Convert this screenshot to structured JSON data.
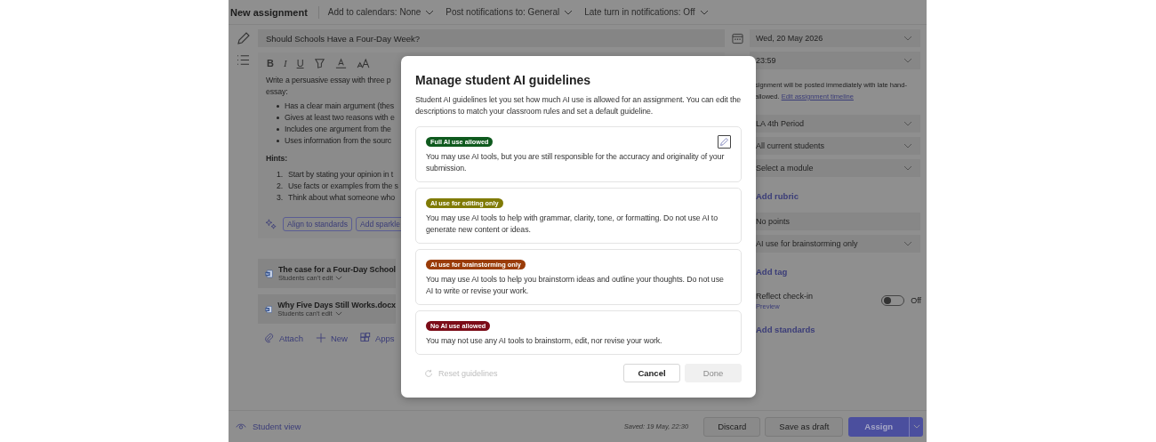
{
  "top_bar": {
    "title": "New assignment",
    "menus": [
      {
        "label": "Add to calendars: None"
      },
      {
        "label": "Post notifications to: General"
      },
      {
        "label": "Late turn in notifications: Off"
      }
    ]
  },
  "title_field": {
    "value": "Should Schools Have a Four-Day Week?"
  },
  "editor": {
    "format_buttons": [
      {
        "kind": "bold",
        "label": "B"
      },
      {
        "kind": "italic",
        "label": "I"
      },
      {
        "kind": "underline",
        "label": "U"
      }
    ],
    "intro": [
      "Write a persuasive essay with three p",
      "essay:"
    ],
    "bullets": [
      "Has a clear main argument (thes",
      "Gives at least two reasons with e",
      "Includes one argument from the",
      "Uses information from the sourc"
    ],
    "hints_heading": "Hints:",
    "steps": [
      {
        "number": "1.",
        "text": "Start by stating your opinion in t"
      },
      {
        "number": "2.",
        "text": "Use facts or examples from the s"
      },
      {
        "number": "3.",
        "text": "Think about what someone who"
      }
    ],
    "ai_buttons": [
      "Align to standards",
      "Add sparkle"
    ]
  },
  "attachments": [
    {
      "name": "The case for a Four-Day School",
      "permission": "Students can't edit"
    },
    {
      "name": "Why Five Days Still Works.docx",
      "permission": "Students can't edit"
    }
  ],
  "attach_actions": [
    {
      "kind": "attach",
      "label": "Attach"
    },
    {
      "kind": "new",
      "label": "New"
    },
    {
      "kind": "apps",
      "label": "Apps"
    }
  ],
  "details": [
    {
      "kind": "dropdown",
      "value": "Wed, 20 May 2026"
    },
    {
      "kind": "dropdown",
      "value": "23:59"
    },
    {
      "kind": "note",
      "lines": [
        "signment will be posted immediately with late hand-",
        "allowed."
      ],
      "link": "Edit assignment timeline"
    },
    {
      "kind": "dropdown",
      "value": "LA 4th Period"
    },
    {
      "kind": "dropdown",
      "value": "All current students"
    },
    {
      "kind": "dropdown",
      "value": "Select a module"
    },
    {
      "kind": "link",
      "label": "Add rubric"
    },
    {
      "kind": "field",
      "value": "No points"
    },
    {
      "kind": "dropdown",
      "value": "AI use for brainstorming only"
    },
    {
      "kind": "link",
      "label": "Add tag"
    },
    {
      "kind": "toggle",
      "label": "Reflect check-in",
      "badge": "Preview",
      "on": false,
      "state_text": "Off"
    },
    {
      "kind": "link",
      "label": "Add standards"
    }
  ],
  "footer": {
    "student_view": "Student view",
    "saved": "Saved: 19 May, 22:30",
    "discard": "Discard",
    "save_draft": "Save as draft",
    "assign": "Assign"
  },
  "dialog": {
    "title": "Manage student AI guidelines",
    "description": "Student AI guidelines let you set how much AI use is allowed for an assignment. You can edit the descriptions to match your classroom rules and set a default guideline.",
    "guidelines": [
      {
        "label": "Full AI use allowed",
        "color": "#0f5a1e",
        "text": "You may use AI tools, but you are still responsible for the accuracy and originality of your submission.",
        "edit_button": true
      },
      {
        "label": "AI use for editing only",
        "color": "#807b06",
        "text": "You may use AI tools to help with grammar, clarity, tone, or formatting. Do not use AI to generate new content or ideas.",
        "edit_button": false
      },
      {
        "label": "AI use for brainstorming only",
        "color": "#9a3c08",
        "text": "You may use AI tools to help you brainstorm ideas and outline your thoughts. Do not use AI to write or revise your work.",
        "edit_button": false
      },
      {
        "label": "No AI use allowed",
        "color": "#7c0c18",
        "text": "You may not use any AI tools to brainstorm, edit, nor revise your work.",
        "edit_button": false
      }
    ],
    "reset": {
      "label": "Reset guidelines",
      "disabled": true
    },
    "buttons": [
      {
        "label": "Cancel",
        "disabled": false
      },
      {
        "label": "Done",
        "disabled": true
      }
    ]
  }
}
